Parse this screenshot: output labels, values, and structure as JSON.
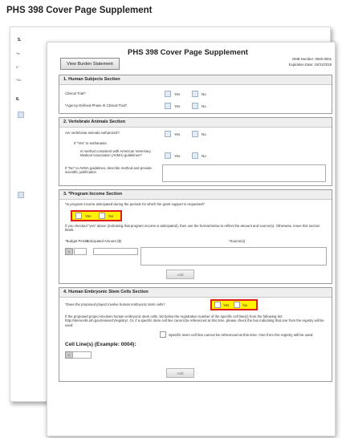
{
  "form_title": "PHS 398 Cover Page Supplement",
  "back_page": {
    "section_label": "5.",
    "row_labels": [
      "*Is",
      "If \"",
      "*Dc"
    ],
    "section6_label": "6."
  },
  "header": {
    "burden_button": "View Burden Statement",
    "omb_number": "OMB Number: 0925-0001",
    "expiration": "Expiration Date: 10/31/2018"
  },
  "options": {
    "yes": "Yes",
    "no": "No"
  },
  "section1": {
    "title": "1. Human Subjects Section",
    "q1": "Clinical Trial?",
    "q2": "*Agency-Defined Phase III Clinical Trial?"
  },
  "section2": {
    "title": "2. Vertebrate Animals Section",
    "q1": "Are vertebrate animals euthanized?",
    "q2": "If \"Yes\" to euthanasia",
    "q3": "Is method consistent with American Veterinary Medical Association (AVMA) guidelines?",
    "q4": "If \"No\" to AVMA guidelines, describe method and provide scientific justification"
  },
  "section3": {
    "title": "3. *Program Income Section",
    "q1": "*Is program income anticipated during the periods for which the grant support is requested?",
    "note": "If you checked \"yes\" above (indicating that program income is anticipated), then use the format below to reflect the amount and source(s). Otherwise, leave this section blank.",
    "col_budget_period": "*Budget Period",
    "col_amount": "*Anticipated Amount ($)",
    "col_sources": "*Source(s)",
    "add_button": "Add"
  },
  "section4": {
    "title": "4. Human Embryonic Stem Cells Section",
    "q1": "*Does the proposed project involve human embryonic stem cells?",
    "note": "If the proposed project involves human embryonic stem cells, list below the registration number of the specific cell line(s) from the following list: http://stemcells.nih.gov/research/registry/. Or, if a specific  stem cell line cannot be referenced at this time, please check the box indicating that one from the registry will be used:",
    "checkbox_label": "Specific stem cell line cannot be referenced at this time.  One from the registry will be used.",
    "cell_lines_label": "Cell Line(s) (Example: 0004):",
    "add_button": "Add"
  }
}
